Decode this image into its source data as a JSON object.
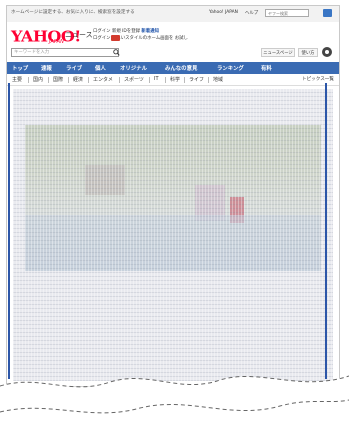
{
  "topbar": {
    "message": "ホームページに設定する、お気に入りに、検索窓を設定する",
    "links": [
      "Yahoo! JAPAN",
      "ヘルプ"
    ],
    "search_placeholder": "ヤフー検索"
  },
  "logo": {
    "text": "YAHOO!",
    "sub": "JAPAN",
    "label": "ニュース"
  },
  "logo_links": {
    "line1": "ログイン 新規 IDを登録",
    "line1_highlight": "新着通知",
    "line2": "ログイン",
    "line2_detail": "新しいスタイルのホーム画面を お試し"
  },
  "search": {
    "placeholder": "キーワードを入力"
  },
  "right_buttons": [
    "ニュースページ",
    "使い方"
  ],
  "nav": {
    "items": [
      "トップ",
      "速報",
      "ライブ",
      "個人",
      "オリジナル",
      "みんなの意見",
      "ランキング",
      "有料"
    ]
  },
  "subnav": {
    "items": [
      "主要",
      "国内",
      "国際",
      "経済",
      "エンタメ",
      "スポーツ",
      "IT",
      "科学",
      "ライフ",
      "地域"
    ],
    "right": "トピックス一覧"
  },
  "colors": {
    "nav_bg": "#3a6bb3",
    "logo_red": "#ff0033",
    "page_bg": "#ffffff"
  }
}
